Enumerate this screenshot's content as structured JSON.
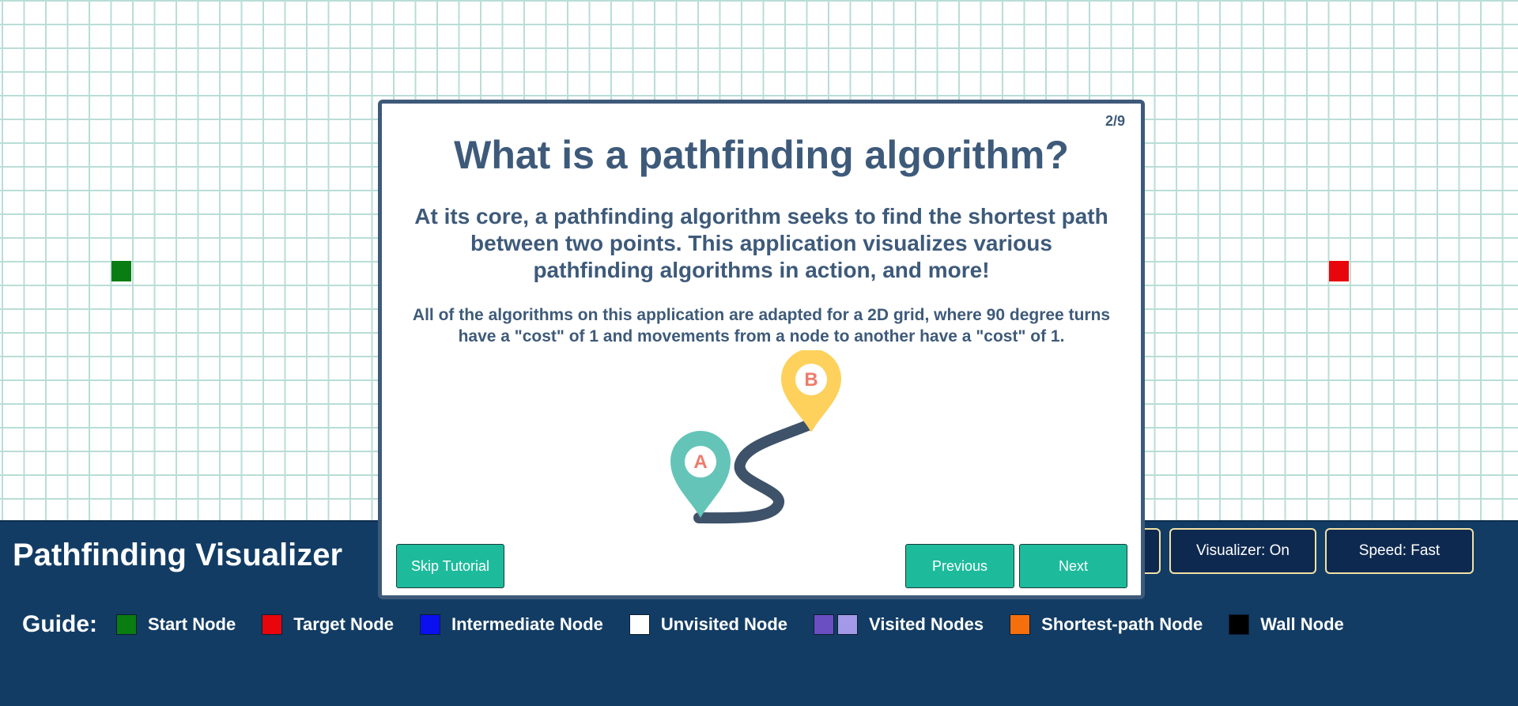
{
  "app": {
    "title": "Pathfinding Visualizer"
  },
  "controls": {
    "partial_label": "",
    "visualizer_label": "Visualizer: On",
    "speed_label": "Speed: Fast"
  },
  "guide": {
    "label": "Guide:",
    "items": [
      {
        "label": "Start Node",
        "colors": [
          "#0a7d12"
        ]
      },
      {
        "label": "Target Node",
        "colors": [
          "#e8060c"
        ]
      },
      {
        "label": "Intermediate Node",
        "colors": [
          "#0a10f0"
        ]
      },
      {
        "label": "Unvisited Node",
        "colors": [
          "#ffffff"
        ]
      },
      {
        "label": "Visited Nodes",
        "colors": [
          "#6a4fc2",
          "#a399e8"
        ]
      },
      {
        "label": "Shortest-path Node",
        "colors": [
          "#f5700d"
        ]
      },
      {
        "label": "Wall Node",
        "colors": [
          "#000000"
        ]
      }
    ]
  },
  "grid": {
    "start_color": "#0a7d12",
    "target_color": "#e8060c",
    "line_color": "#b9ddd7"
  },
  "tutorial": {
    "counter": "2/9",
    "title": "What is a pathfinding algorithm?",
    "lead": "At its core, a pathfinding algorithm seeks to find the shortest path between two points. This application visualizes various pathfinding algorithms in action, and more!",
    "detail": "All of the algorithms on this application are adapted for a 2D grid, where 90 degree turns have a \"cost\" of 1 and movements from a node to another have a \"cost\" of 1.",
    "pin_a_label": "A",
    "pin_b_label": "B",
    "skip_label": "Skip Tutorial",
    "previous_label": "Previous",
    "next_label": "Next"
  }
}
